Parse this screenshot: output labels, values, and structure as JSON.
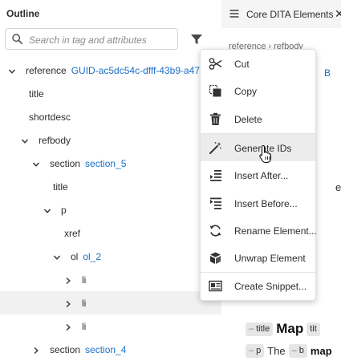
{
  "outline": {
    "title": "Outline",
    "search_placeholder": "Search in tag and attributes",
    "tree": [
      {
        "name": "reference",
        "attr": "GUID-ac5dc54c-dfff-43b9-a473-",
        "chevron": "down"
      },
      {
        "name": "title",
        "attr": "",
        "chevron": "none"
      },
      {
        "name": "shortdesc",
        "attr": "",
        "chevron": "none"
      },
      {
        "name": "refbody",
        "attr": "",
        "chevron": "down"
      },
      {
        "name": "section",
        "attr": "section_5",
        "chevron": "down"
      },
      {
        "name": "title",
        "attr": "",
        "chevron": "none"
      },
      {
        "name": "p",
        "attr": "",
        "chevron": "down"
      },
      {
        "name": "xref",
        "attr": "",
        "chevron": "none"
      },
      {
        "name": "ol",
        "attr": "ol_2",
        "chevron": "down"
      },
      {
        "name": "li",
        "attr": "",
        "chevron": "right"
      },
      {
        "name": "li",
        "attr": "",
        "chevron": "right",
        "selected": true
      },
      {
        "name": "li",
        "attr": "",
        "chevron": "right"
      },
      {
        "name": "section",
        "attr": "section_4",
        "chevron": "right"
      }
    ]
  },
  "right_panel": {
    "title": "Core DITA Elements",
    "close_glyph": "✕",
    "breadcrumb": "reference  ›  refbody",
    "guid_fragment": "B",
    "letter_fragment": "e",
    "line1": {
      "pill1": "title",
      "map_word": "Map",
      "pill2": "tit"
    },
    "line2": {
      "pill1": "p",
      "the_word": "The",
      "pill2": "b",
      "bold_word": "map"
    }
  },
  "context_menu": {
    "items": [
      {
        "label": "Cut",
        "icon": "scissors-icon"
      },
      {
        "label": "Copy",
        "icon": "copy-icon"
      },
      {
        "label": "Delete",
        "icon": "trash-icon"
      },
      {
        "label": "Generate IDs",
        "icon": "magic-wand-icon",
        "hover": true
      },
      {
        "label": "Insert After...",
        "icon": "insert-after-icon"
      },
      {
        "label": "Insert Before...",
        "icon": "insert-before-icon"
      },
      {
        "label": "Rename Element...",
        "icon": "rename-icon"
      },
      {
        "label": "Unwrap Element",
        "icon": "unwrap-icon"
      },
      {
        "label": "Create Snippet...",
        "icon": "snippet-icon"
      }
    ]
  },
  "colors": {
    "link": "#1a6fc8",
    "text": "#2c2c2c",
    "selected_row": "#f1f1f1",
    "menu_hover": "#ececec"
  }
}
